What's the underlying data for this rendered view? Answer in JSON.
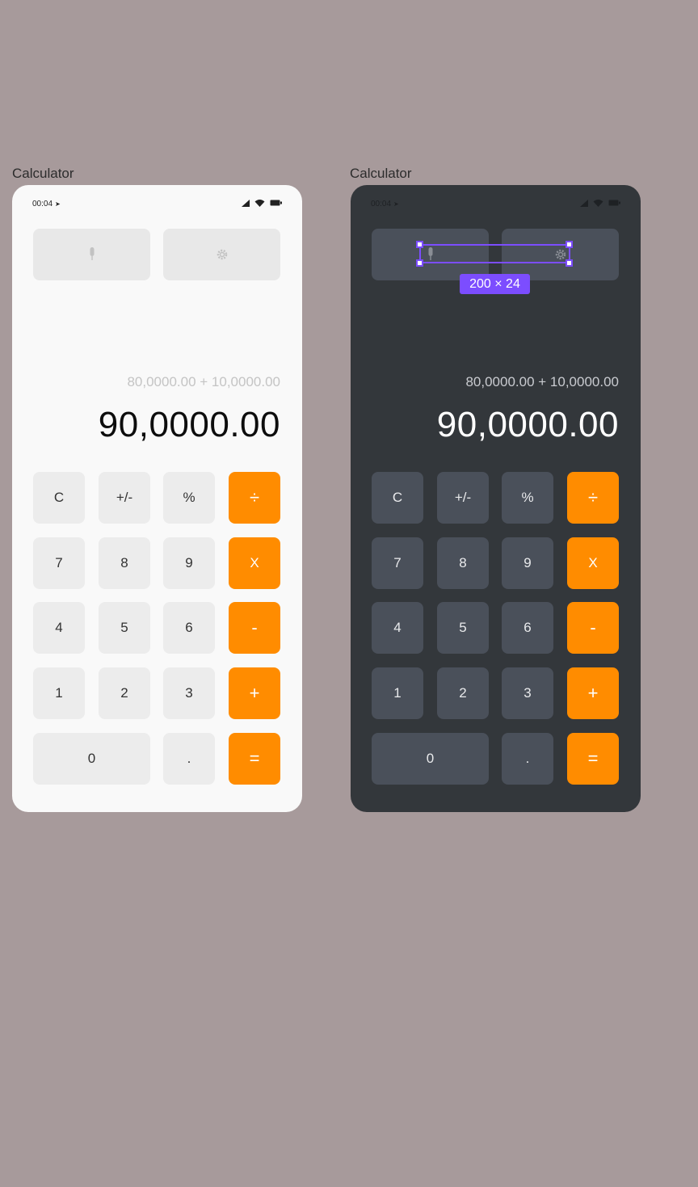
{
  "frames": {
    "light": {
      "title": "Calculator"
    },
    "dark": {
      "title": "Calculator"
    }
  },
  "status": {
    "time": "00:04"
  },
  "display": {
    "expression": "80,0000.00 + 10,0000.00",
    "result": "90,0000.00"
  },
  "keys": {
    "clear": "C",
    "sign": "+/-",
    "percent": "%",
    "divide": "÷",
    "seven": "7",
    "eight": "8",
    "nine": "9",
    "multiply": "X",
    "four": "4",
    "five": "5",
    "six": "6",
    "minus": "-",
    "one": "1",
    "two": "2",
    "three": "3",
    "plus": "+",
    "zero": "0",
    "dot": ".",
    "equals": "="
  },
  "icons": {
    "mic": "microphone-icon",
    "settings": "gear-icon"
  },
  "selection": {
    "size_label": "200 × 24"
  },
  "colors": {
    "canvas": "#a79a9b",
    "light_bg": "#f9f9f9",
    "dark_bg": "#33373b",
    "accent": "#ff8c00",
    "selection": "#7c4dff"
  }
}
